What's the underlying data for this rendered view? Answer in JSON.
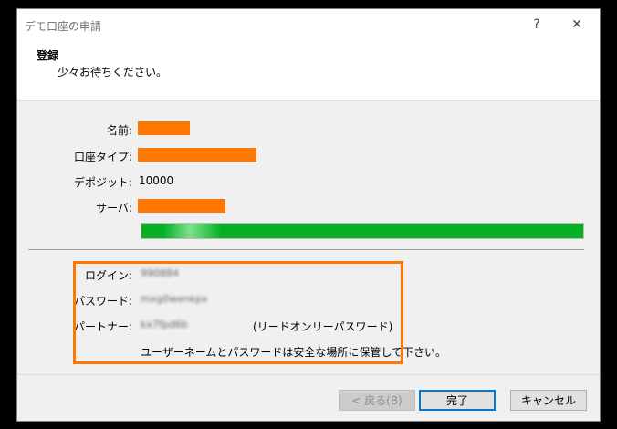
{
  "window": {
    "title": "デモ口座の申請",
    "help_label": "?",
    "close_label": "✕"
  },
  "header": {
    "title": "登録",
    "subtitle": "少々お待ちください。"
  },
  "fields": {
    "name_label": "名前:",
    "account_type_label": "口座タイプ:",
    "deposit_label": "デポジット:",
    "deposit_value": "10000",
    "server_label": "サーバ:"
  },
  "progress": {
    "fraction": 1.0,
    "color": "#06b025"
  },
  "credentials": {
    "login_label": "ログイン:",
    "login_value": "990884",
    "password_label": "パスワード:",
    "password_value": "mxg0wenkpx",
    "partner_label": "パートナー:",
    "partner_value": "kx7fpd6b",
    "readonly_note": "(リードオンリーパスワード)",
    "safekeep_note": "ユーザーネームとパスワードは安全な場所に保管して下さい。"
  },
  "buttons": {
    "back": "< 戻る(B)",
    "finish": "完了",
    "cancel": "キャンセル"
  },
  "colors": {
    "highlight": "#ff7700",
    "redaction": "#ff7700",
    "progress": "#06b025"
  }
}
